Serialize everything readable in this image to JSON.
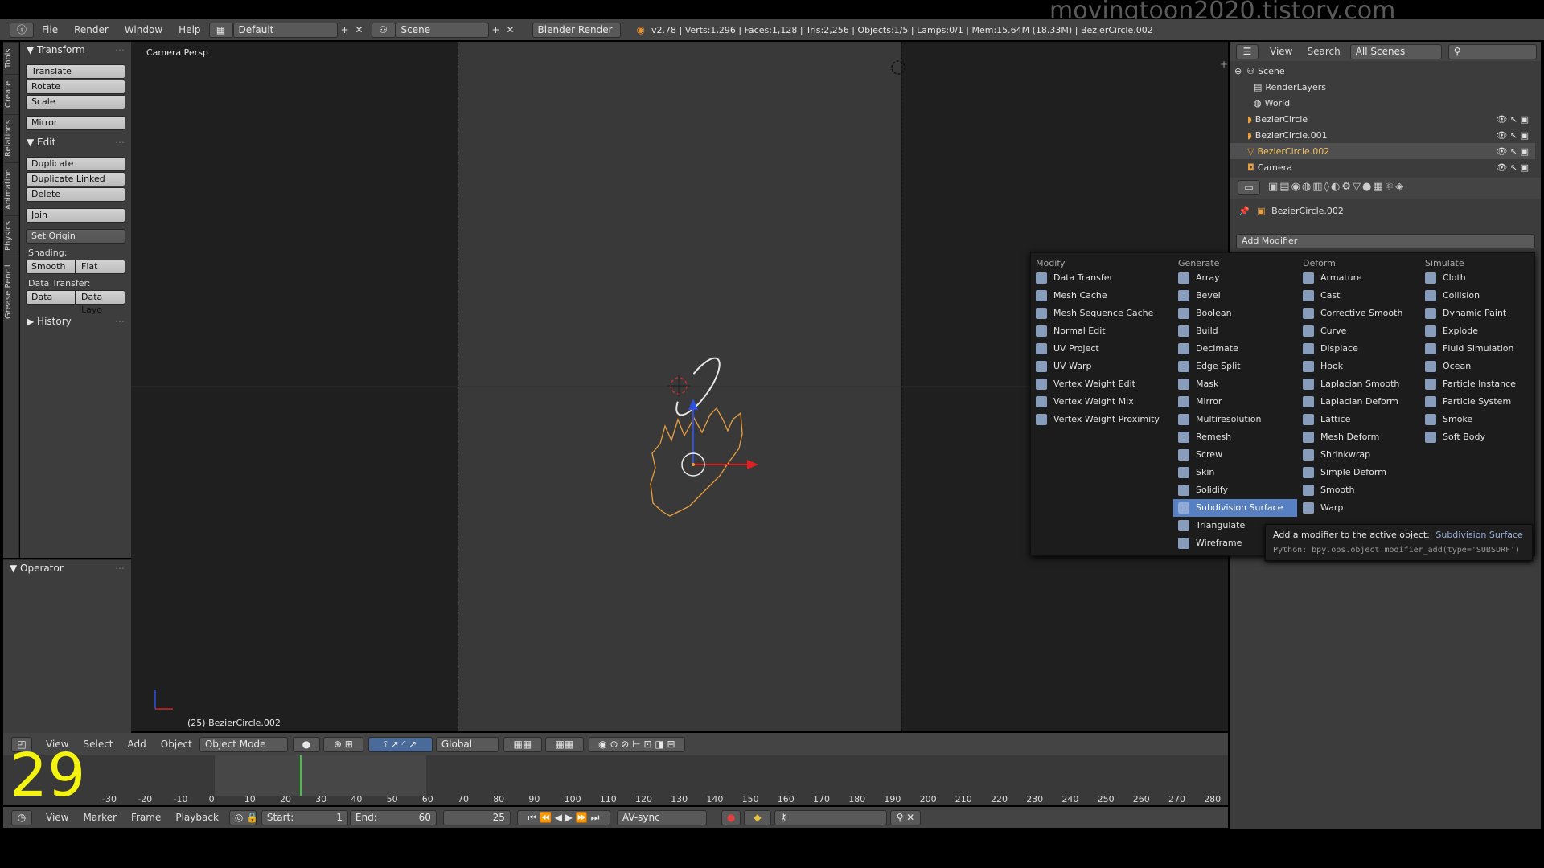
{
  "watermark": "movingtoon2020.tistory.com",
  "topbar": {
    "menus": [
      "File",
      "Render",
      "Window",
      "Help"
    ],
    "layout": "Default",
    "scene": "Scene",
    "engine": "Blender Render",
    "stats": "v2.78 | Verts:1,296 | Faces:1,128 | Tris:2,256 | Objects:1/5 | Lamps:0/1 | Mem:15.64M (18.33M) | BezierCircle.002"
  },
  "lefttabs": [
    "Tools",
    "Create",
    "Relations",
    "Animation",
    "Physics",
    "Grease Pencil"
  ],
  "toolshelf": {
    "transform_title": "Transform",
    "translate": "Translate",
    "rotate": "Rotate",
    "scale": "Scale",
    "mirror": "Mirror",
    "edit_title": "Edit",
    "duplicate": "Duplicate",
    "duplicate_linked": "Duplicate Linked",
    "delete": "Delete",
    "join": "Join",
    "set_origin": "Set Origin",
    "shading_label": "Shading:",
    "smooth": "Smooth",
    "flat": "Flat",
    "data_transfer_label": "Data Transfer:",
    "data": "Data",
    "data_layout": "Data Layo",
    "history_title": "History",
    "operator_title": "Operator"
  },
  "viewport": {
    "label": "Camera Persp",
    "object_label": "(25) BezierCircle.002"
  },
  "header3d": {
    "menus": [
      "View",
      "Select",
      "Add",
      "Object"
    ],
    "mode": "Object Mode",
    "orientation": "Global"
  },
  "timeline": {
    "big_number": "29",
    "ticks": [
      "-30",
      "-20",
      "-10",
      "0",
      "10",
      "20",
      "30",
      "40",
      "50",
      "60",
      "70",
      "80",
      "90",
      "100",
      "110",
      "120",
      "130",
      "140",
      "150",
      "160",
      "170",
      "180",
      "190",
      "200",
      "210",
      "220",
      "230",
      "240",
      "250",
      "260",
      "270",
      "280"
    ],
    "menus": [
      "View",
      "Marker",
      "Frame",
      "Playback"
    ],
    "start_label": "Start:",
    "start": "1",
    "end_label": "End:",
    "end": "60",
    "current": "25",
    "sync": "AV-sync"
  },
  "outliner": {
    "view": "View",
    "search": "Search",
    "filter": "All Scenes",
    "rows": [
      "Scene",
      "RenderLayers",
      "World",
      "BezierCircle",
      "BezierCircle.001",
      "BezierCircle.002",
      "Camera"
    ]
  },
  "properties": {
    "object_name": "BezierCircle.002",
    "add_modifier": "Add Modifier"
  },
  "menu": {
    "modify_title": "Modify",
    "modify": [
      "Data Transfer",
      "Mesh Cache",
      "Mesh Sequence Cache",
      "Normal Edit",
      "UV Project",
      "UV Warp",
      "Vertex Weight Edit",
      "Vertex Weight Mix",
      "Vertex Weight Proximity"
    ],
    "generate_title": "Generate",
    "generate": [
      "Array",
      "Bevel",
      "Boolean",
      "Build",
      "Decimate",
      "Edge Split",
      "Mask",
      "Mirror",
      "Multiresolution",
      "Remesh",
      "Screw",
      "Skin",
      "Solidify",
      "Subdivision Surface",
      "Triangulate",
      "Wireframe"
    ],
    "deform_title": "Deform",
    "deform": [
      "Armature",
      "Cast",
      "Corrective Smooth",
      "Curve",
      "Displace",
      "Hook",
      "Laplacian Smooth",
      "Laplacian Deform",
      "Lattice",
      "Mesh Deform",
      "Shrinkwrap",
      "Simple Deform",
      "Smooth",
      "Warp"
    ],
    "simulate_title": "Simulate",
    "simulate": [
      "Cloth",
      "Collision",
      "Dynamic Paint",
      "Explode",
      "Fluid Simulation",
      "Ocean",
      "Particle Instance",
      "Particle System",
      "Smoke",
      "Soft Body"
    ],
    "selected": "Subdivision Surface"
  },
  "tooltip": {
    "line1": "Add a modifier to the active object:",
    "line1_value": "Subdivision Surface",
    "line2": "Python: bpy.ops.object.modifier_add(type='SUBSURF')"
  },
  "colors": {
    "selection": "#5680c2",
    "object_orange": "#e8a040",
    "highlight_yellow": "#f4f410"
  }
}
